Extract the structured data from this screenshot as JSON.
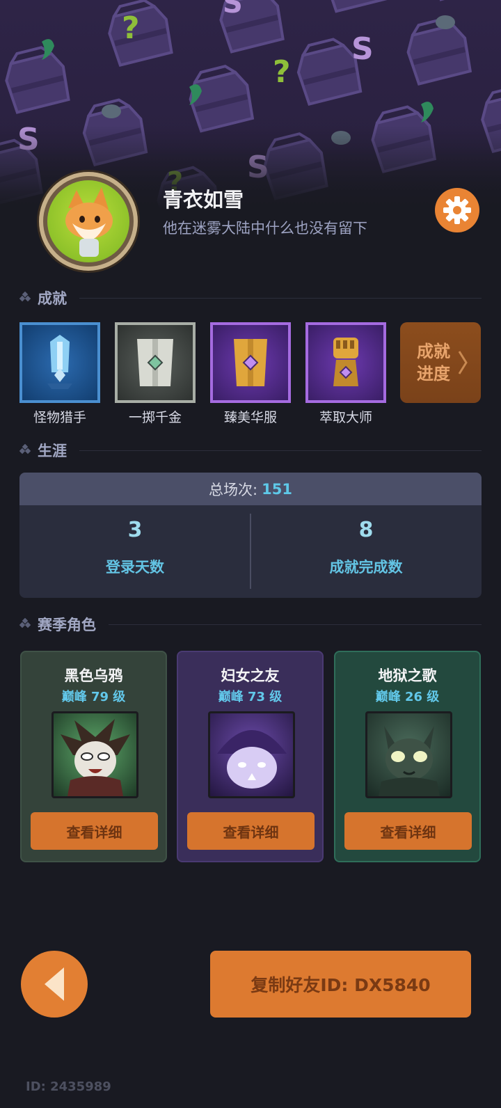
{
  "profile": {
    "nickname": "青衣如雪",
    "signature": "他在迷雾大陆中什么也没有留下"
  },
  "achievements": {
    "title": "成就",
    "items": [
      {
        "label": "怪物猎手",
        "color": "#1f6fb4"
      },
      {
        "label": "一掷千金",
        "color": "#9aa09a"
      },
      {
        "label": "臻美华服",
        "color": "#7c3ec2"
      },
      {
        "label": "萃取大师",
        "color": "#7c3ec2"
      }
    ],
    "progress_label": "成就进度"
  },
  "career": {
    "title": "生涯",
    "total_label": "总场次:",
    "total_value": "151",
    "stats": [
      {
        "value": "3",
        "label": "登录天数"
      },
      {
        "value": "8",
        "label": "成就完成数"
      }
    ]
  },
  "season": {
    "title": "赛季角色",
    "heroes": [
      {
        "name": "黑色乌鸦",
        "level": "巅峰 79 级",
        "button": "查看详细",
        "bg": "#34433a",
        "border": "#3f5247"
      },
      {
        "name": "妇女之友",
        "level": "巅峰 73 级",
        "button": "查看详细",
        "bg": "#3a2e5a",
        "border": "#4a3a72"
      },
      {
        "name": "地狱之歌",
        "level": "巅峰 26 级",
        "button": "查看详细",
        "bg": "#23493e",
        "border": "#2f6e5a"
      }
    ]
  },
  "footer": {
    "copy_button": "复制好友ID: DX5840",
    "player_id": "ID: 2435989"
  },
  "colors": {
    "accent": "#e27f33",
    "highlight": "#62c8ea",
    "background": "#191a22"
  }
}
